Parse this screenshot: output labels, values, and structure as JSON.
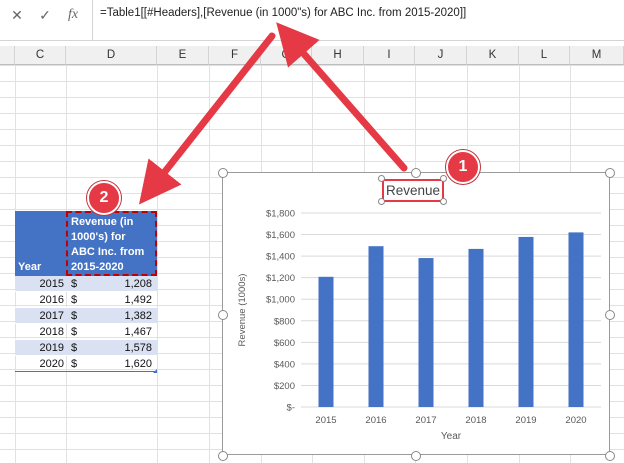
{
  "formula_bar": {
    "cancel_icon": "x-icon",
    "enter_icon": "check-icon",
    "fx_label": "fx",
    "formula": "=Table1[[#Headers],[Revenue (in 1000\"s) for ABC Inc. from 2015-2020]]"
  },
  "columns": [
    "C",
    "D",
    "E",
    "F",
    "G",
    "H",
    "I",
    "J",
    "K",
    "L",
    "M"
  ],
  "table": {
    "headers": [
      "Year",
      "Revenue (in 1000's) for ABC Inc. from 2015-2020"
    ],
    "rows": [
      {
        "year": "2015",
        "currency": "$",
        "amount": "1,208"
      },
      {
        "year": "2016",
        "currency": "$",
        "amount": "1,492"
      },
      {
        "year": "2017",
        "currency": "$",
        "amount": "1,382"
      },
      {
        "year": "2018",
        "currency": "$",
        "amount": "1,467"
      },
      {
        "year": "2019",
        "currency": "$",
        "amount": "1,578"
      },
      {
        "year": "2020",
        "currency": "$",
        "amount": "1,620"
      }
    ]
  },
  "callouts": {
    "one": "1",
    "two": "2"
  },
  "colors": {
    "accent": "#4472c4",
    "highlight": "#e53945",
    "band": "#d9e1f2"
  },
  "chart_data": {
    "type": "bar",
    "title": "Revenue",
    "xlabel": "Year",
    "ylabel": "Revenue (1000s)",
    "categories": [
      "2015",
      "2016",
      "2017",
      "2018",
      "2019",
      "2020"
    ],
    "values": [
      1208,
      1492,
      1382,
      1467,
      1578,
      1620
    ],
    "ylim": [
      0,
      1800
    ],
    "yticks": [
      "$-",
      "$200",
      "$400",
      "$600",
      "$800",
      "$1,000",
      "$1,200",
      "$1,400",
      "$1,600",
      "$1,800"
    ],
    "grid": true,
    "legend": "none"
  }
}
